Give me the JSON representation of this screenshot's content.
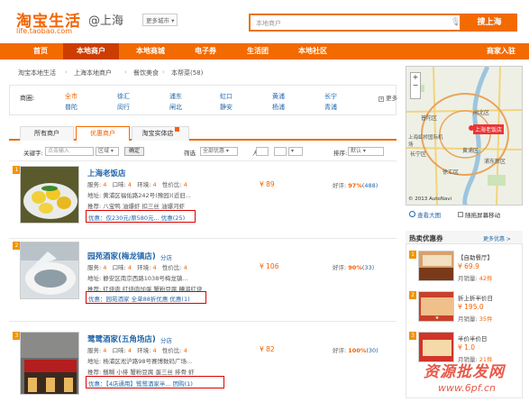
{
  "header": {
    "logo_cn": "淘宝生活",
    "logo_url": "life.taobao.com",
    "city": "@上海",
    "city_switch": "更多城市",
    "search_placeholder": "本地商户",
    "search_button": "搜上海"
  },
  "nav": {
    "items": [
      "首页",
      "本地商户",
      "本地商城",
      "电子券",
      "生活团",
      "本地社区"
    ],
    "right": "商家入驻",
    "active_index": 1
  },
  "breadcrumb": [
    "淘宝本地生活",
    "上海本地商户",
    "餐饮美食",
    "本帮菜(58)"
  ],
  "filter": {
    "label": "商圈:",
    "districts": [
      [
        "全市",
        "徐汇",
        "浦东",
        "虹口",
        "黄浦",
        "长宁"
      ],
      [
        "普陀",
        "闵行",
        "闸北",
        "静安",
        "杨浦",
        "青浦"
      ]
    ],
    "more": "更多"
  },
  "tabs": {
    "items": [
      "所有商户",
      "优惠商户",
      "淘宝实体店"
    ],
    "active_index": 1
  },
  "toolbar": {
    "keyword_label": "关键字:",
    "keyword_placeholder": "点击输入",
    "district_placeholder": "区域",
    "confirm": "确定",
    "filter_label": "筛选",
    "filter_value": "全部优惠",
    "avg_label": "人均",
    "to": "-",
    "sort_label": "排序:",
    "sort_value": "默认"
  },
  "shops": [
    {
      "num": "1",
      "name": "上海老饭店",
      "branch": "",
      "kouwei": "4",
      "huanjing": "4",
      "fuwu": "4",
      "xingjia": "4",
      "address": "黄浦区福佑路242号(豫园)(近旧...",
      "tags": "八宝鸭 油爆虾 扣三丝 油爆河虾",
      "promo": "优惠：仅230元/原580元... 优惠(25)",
      "price": "¥ 89",
      "rate": "97%",
      "count": "(488)"
    },
    {
      "num": "2",
      "name": "园苑酒家(梅龙镇店)",
      "branch": "分店",
      "kouwei": "4",
      "huanjing": "4",
      "fuwu": "4",
      "xingjia": "4",
      "address": "静安区南京西路1038号梅龙镇...",
      "tags": "红烧肉 红烧肉加蛋 蟹粉豆腐 糟溜红烧",
      "promo": "优惠：园苑酒家 全单88折优惠  优惠(1)",
      "price": "¥ 106",
      "rate": "90%",
      "count": "(33)"
    },
    {
      "num": "3",
      "name": "鹭鹭酒家(五角场店)",
      "branch": "分店",
      "kouwei": "4",
      "huanjing": "4",
      "fuwu": "4",
      "xingjia": "4",
      "address": "杨浦区淞沪路98号赛博数码广场...",
      "tags": "鳝糊 小排 蟹粉豆腐 蛋三丝 排骨 虾",
      "promo": "优惠：【4店通用】鹭鹭酒家半...  团购(1)",
      "price": "¥ 82",
      "rate": "100%",
      "count": "(30)"
    }
  ],
  "shop_fields": {
    "fuwu": "服务:",
    "kouwei": "口味:",
    "huanjing": "环境:",
    "xingjia": "性价比:",
    "address": "地址:",
    "recommend": "推荐:",
    "rating": "好评:"
  },
  "map": {
    "copyright": "© 2013 AutoNavi",
    "tooltip": "上海老饭店",
    "labels": [
      "普陀区",
      "闸北区",
      "长宁区",
      "徐汇区",
      "浦东新区",
      "上海虹桥国际机场",
      "黄浦区"
    ],
    "ctl_enlarge": "查看大图",
    "ctl_follow": "随拖屏幕移动"
  },
  "coupons": {
    "title": "热卖优惠券",
    "more": "更多优惠 >",
    "items": [
      {
        "num": "1",
        "title": "【自助餐厅】",
        "price": "¥ 69.9",
        "sold_label": "月销量:",
        "sold": "42件"
      },
      {
        "num": "2",
        "title": "折上折半价日",
        "price": "¥ 195.0",
        "sold_label": "月销量:",
        "sold": "35件"
      },
      {
        "num": "3",
        "title": "半价半价日",
        "price": "¥ 1.0",
        "sold_label": "月销量:",
        "sold": "21件"
      }
    ]
  },
  "watermark": {
    "line1": "资源批发网",
    "line2": "www.6pf.cn"
  },
  "colors": {
    "brand": "#f26a00",
    "link": "#2266aa",
    "badge": "#f29400",
    "promo_border": "#dd0000"
  }
}
